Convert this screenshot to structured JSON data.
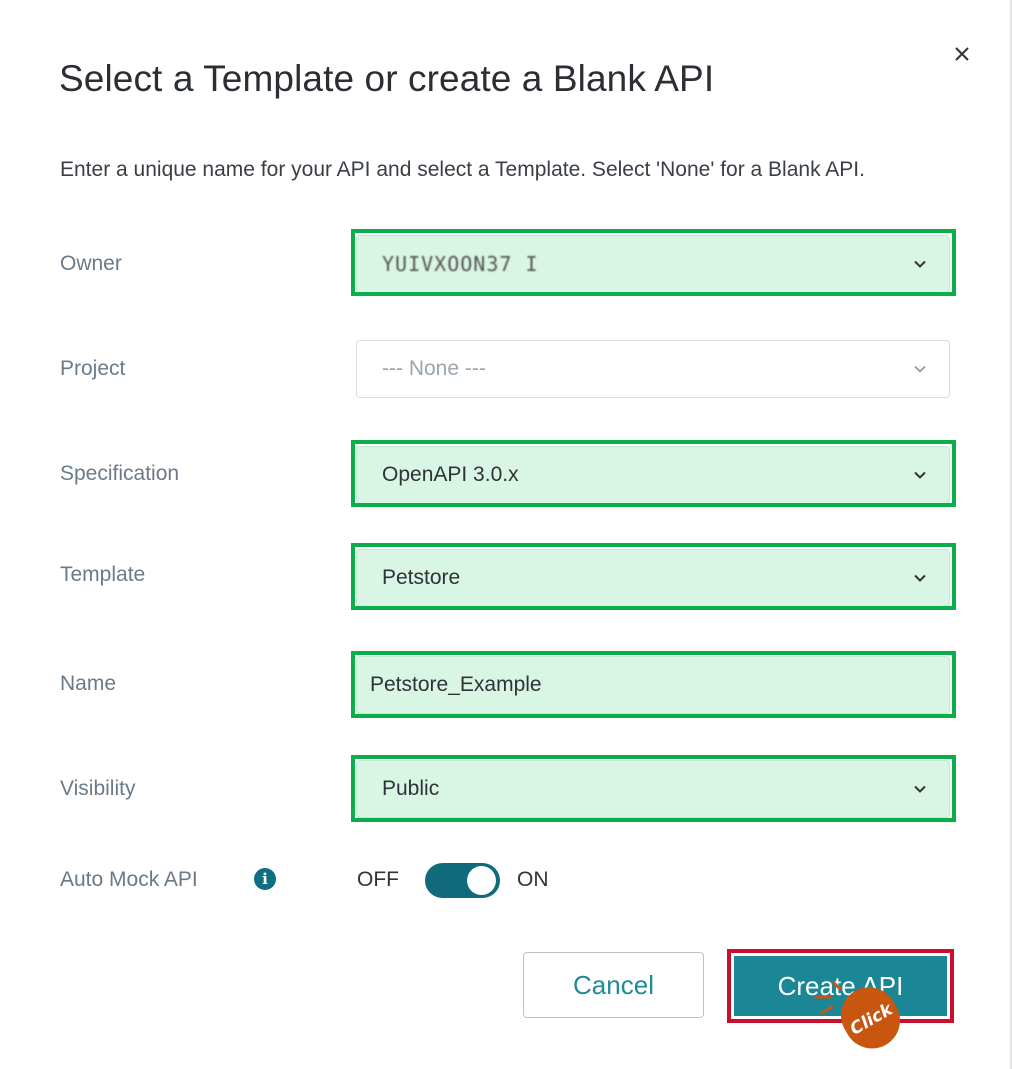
{
  "dialog": {
    "title": "Select a Template or create a Blank API",
    "subtitle": "Enter a unique name for your API and select a Template. Select 'None' for a Blank API.",
    "close_icon": "close-icon"
  },
  "form": {
    "owner": {
      "label": "Owner",
      "value": "YUIVXOON37 I"
    },
    "project": {
      "label": "Project",
      "placeholder": "--- None ---"
    },
    "specification": {
      "label": "Specification",
      "value": "OpenAPI 3.0.x"
    },
    "template": {
      "label": "Template",
      "value": "Petstore"
    },
    "name": {
      "label": "Name",
      "value": "Petstore_Example"
    },
    "visibility": {
      "label": "Visibility",
      "value": "Public"
    },
    "auto_mock": {
      "label": "Auto Mock API",
      "off_label": "OFF",
      "on_label": "ON",
      "state": "on",
      "info_icon": "info-icon"
    }
  },
  "buttons": {
    "cancel": "Cancel",
    "create": "Create API"
  },
  "annotation": {
    "cursor_text": "Click"
  },
  "colors": {
    "highlight_outline": "#0aae4a",
    "highlight_fill": "#d9f5e3",
    "primary": "#1b8796",
    "toggle": "#11697c",
    "callout_outline": "#c8102e",
    "cursor": "#c8560f"
  }
}
